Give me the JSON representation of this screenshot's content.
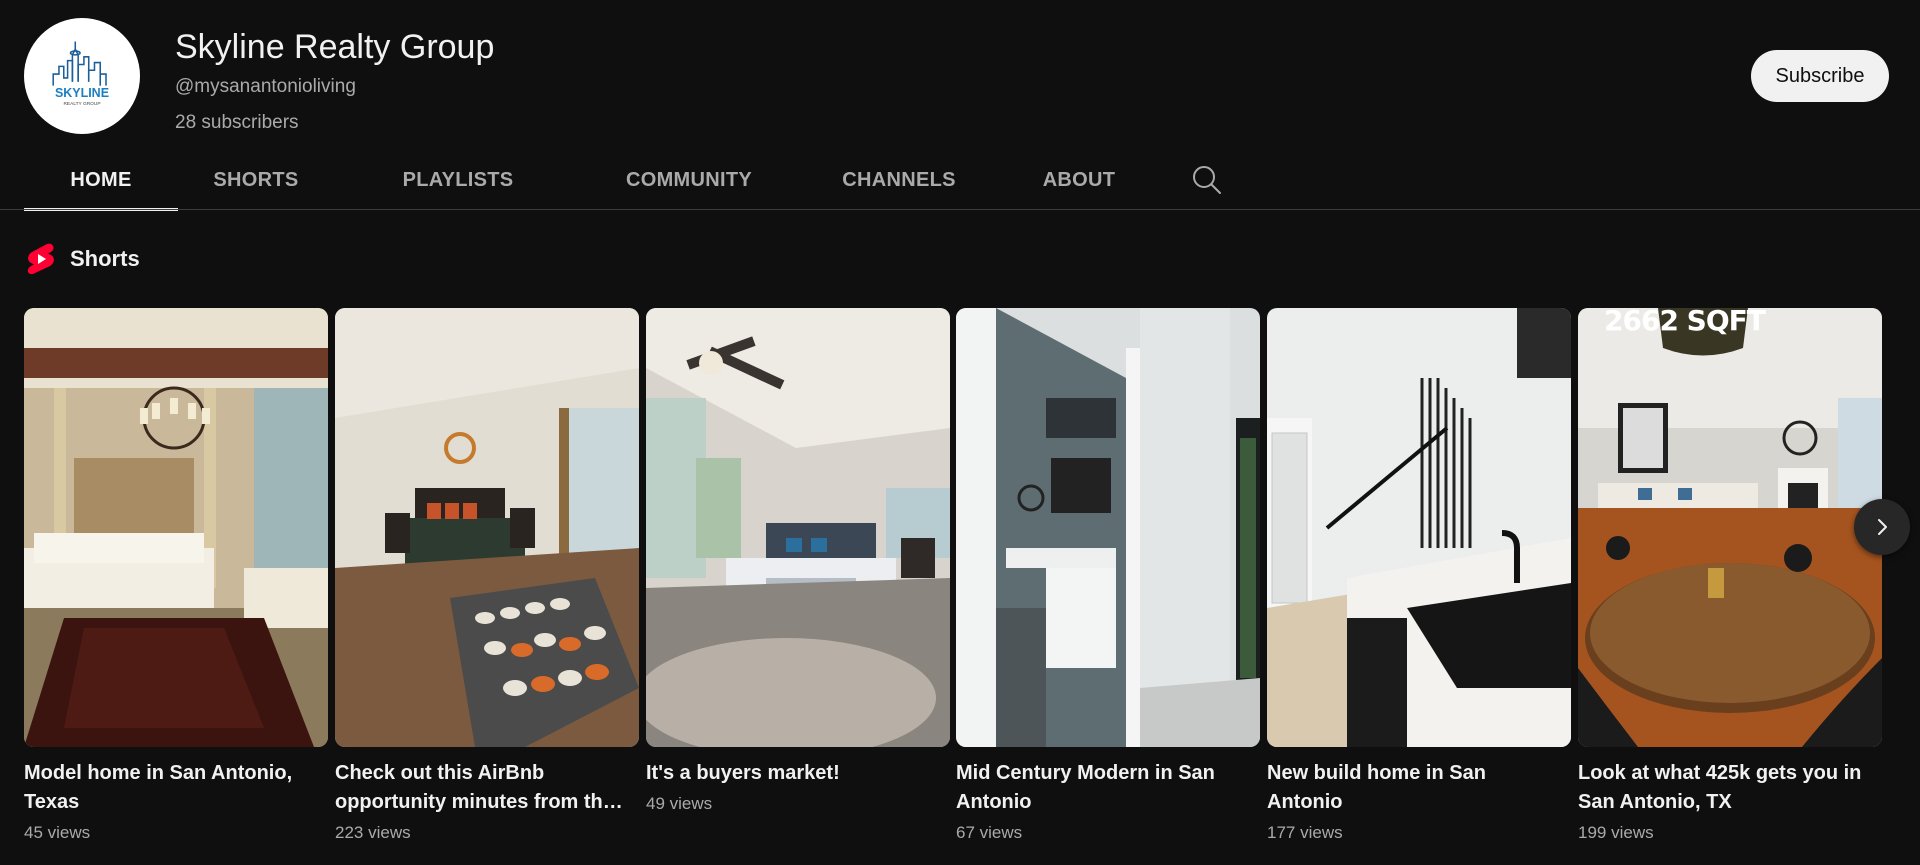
{
  "channel": {
    "name": "Skyline Realty Group",
    "handle": "@mysanantonioliving",
    "subscribers": "28 subscribers",
    "subscribe_label": "Subscribe",
    "avatar_text": "SKYLINE",
    "avatar_subtext": "REALTY GROUP"
  },
  "tabs": [
    {
      "label": "HOME",
      "active": true
    },
    {
      "label": "SHORTS",
      "active": false
    },
    {
      "label": "PLAYLISTS",
      "active": false
    },
    {
      "label": "COMMUNITY",
      "active": false
    },
    {
      "label": "CHANNELS",
      "active": false
    },
    {
      "label": "ABOUT",
      "active": false
    }
  ],
  "search_icon": "search-icon",
  "section": {
    "title": "Shorts",
    "icon": "youtube-shorts-icon"
  },
  "shorts": [
    {
      "title": "Model home in San Antonio, Texas",
      "views": "45 views"
    },
    {
      "title": "Check out this AirBnb opportunity minutes from th…",
      "views": "223 views"
    },
    {
      "title": "It's a buyers market!",
      "views": "49 views"
    },
    {
      "title": "Mid Century Modern in San Antonio",
      "views": "67 views"
    },
    {
      "title": "New build home in San Antonio",
      "views": "177 views"
    },
    {
      "title": "Look at what 425k gets you in San Antonio, TX",
      "views": "199 views",
      "overlay_text": "2662 SQFT"
    }
  ],
  "colors": {
    "background": "#0f0f0f",
    "text_primary": "#f1f1f1",
    "text_secondary": "#aaaaaa",
    "shorts_red": "#ff0033",
    "logo_blue": "#1f6fb2"
  }
}
